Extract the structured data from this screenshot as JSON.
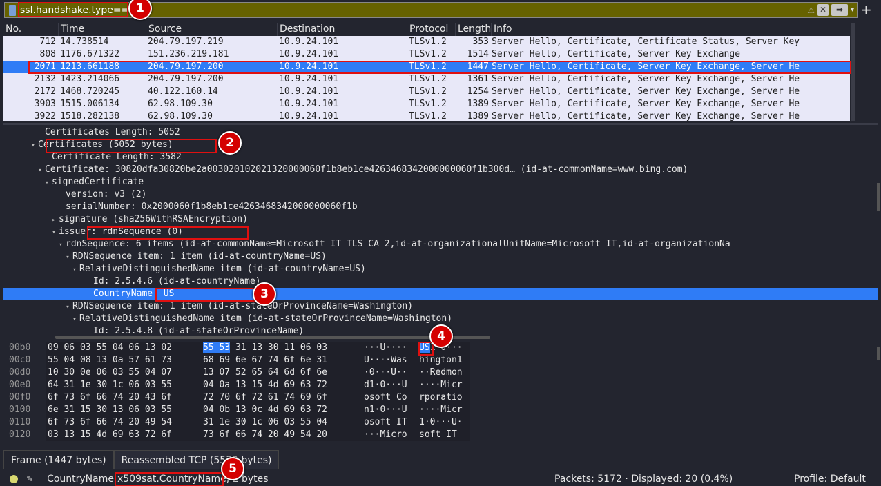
{
  "filter": {
    "value": "ssl.handshake.type==11",
    "clear_icon": "clear-icon",
    "apply_icon": "arrow-right-icon",
    "dropdown_icon": "chevron-down-icon",
    "add_label": "+"
  },
  "packet_list": {
    "columns": [
      "No.",
      "Time",
      "Source",
      "Destination",
      "Protocol",
      "Length",
      "Info"
    ],
    "rows": [
      [
        "712",
        "14.738514",
        "204.79.197.219",
        "10.9.24.101",
        "TLSv1.2",
        "353",
        "Server Hello, Certificate, Certificate Status, Server Key"
      ],
      [
        "808",
        "1176.671322",
        "151.236.219.181",
        "10.9.24.101",
        "TLSv1.2",
        "1514",
        "Server Hello, Certificate, Server Key Exchange"
      ],
      [
        "2071",
        "1213.661188",
        "204.79.197.200",
        "10.9.24.101",
        "TLSv1.2",
        "1447",
        "Server Hello, Certificate, Server Key Exchange, Server He"
      ],
      [
        "2132",
        "1423.214066",
        "204.79.197.200",
        "10.9.24.101",
        "TLSv1.2",
        "1361",
        "Server Hello, Certificate, Server Key Exchange, Server He"
      ],
      [
        "2172",
        "1468.720245",
        "40.122.160.14",
        "10.9.24.101",
        "TLSv1.2",
        "1254",
        "Server Hello, Certificate, Server Key Exchange, Server He"
      ],
      [
        "3903",
        "1515.006134",
        "62.98.109.30",
        "10.9.24.101",
        "TLSv1.2",
        "1389",
        "Server Hello, Certificate, Server Key Exchange, Server He"
      ],
      [
        "3922",
        "1518.282138",
        "62.98.109.30",
        "10.9.24.101",
        "TLSv1.2",
        "1389",
        "Server Hello, Certificate, Server Key Exchange, Server He"
      ]
    ],
    "selected_index": 2
  },
  "details": [
    {
      "text": "Certificates Length: 5052",
      "indent": 4,
      "tw": ""
    },
    {
      "text": "Certificates (5052 bytes)",
      "indent": 3,
      "tw": "▾"
    },
    {
      "text": "Certificate Length: 3582",
      "indent": 5,
      "tw": ""
    },
    {
      "text": "Certificate: 30820dfa30820be2a003020102021320000060f1b8eb1ce4263468342000000060f1b300d… (id-at-commonName=www.bing.com)",
      "indent": 4,
      "tw": "▾"
    },
    {
      "text": "signedCertificate",
      "indent": 5,
      "tw": "▾"
    },
    {
      "text": "version: v3 (2)",
      "indent": 7,
      "tw": ""
    },
    {
      "text": "serialNumber: 0x2000060f1b8eb1ce4263468342000000060f1b",
      "indent": 7,
      "tw": ""
    },
    {
      "text": "signature (sha256WithRSAEncryption)",
      "indent": 6,
      "tw": "▸"
    },
    {
      "text": "issuer: rdnSequence (0)",
      "indent": 6,
      "tw": "▾"
    },
    {
      "text": "rdnSequence: 6 items (id-at-commonName=Microsoft IT TLS CA 2,id-at-organizationalUnitName=Microsoft IT,id-at-organizationNa",
      "indent": 7,
      "tw": "▾"
    },
    {
      "text": "RDNSequence item: 1 item (id-at-countryName=US)",
      "indent": 8,
      "tw": "▾"
    },
    {
      "text": "RelativeDistinguishedName item (id-at-countryName=US)",
      "indent": 9,
      "tw": "▾"
    },
    {
      "text": "Id: 2.5.4.6 (id-at-countryName)",
      "indent": 11,
      "tw": ""
    },
    {
      "text": "CountryName: US",
      "indent": 11,
      "tw": ""
    },
    {
      "text": "RDNSequence item: 1 item (id-at-stateOrProvinceName=Washington)",
      "indent": 8,
      "tw": "▾"
    },
    {
      "text": "RelativeDistinguishedName item (id-at-stateOrProvinceName=Washington)",
      "indent": 9,
      "tw": "▾"
    },
    {
      "text": "Id: 2.5.4.8 (id-at-stateOrProvinceName)",
      "indent": 11,
      "tw": ""
    }
  ],
  "details_selected_index": 13,
  "hex": [
    {
      "off": "00b0",
      "b1": "09 06 03 55 04 06 13 02",
      "b2a": "55 53",
      "b2b": " 31 13 30 11 06 03",
      "a1": "···U····",
      "a2a": "US",
      "a2b": "1·0···"
    },
    {
      "off": "00c0",
      "b1": "55 04 08 13 0a 57 61 73",
      "b2b": "68 69 6e 67 74 6f 6e 31",
      "a1": "U····Was",
      "a2b": "hington1"
    },
    {
      "off": "00d0",
      "b1": "10 30 0e 06 03 55 04 07",
      "b2b": "13 07 52 65 64 6d 6f 6e",
      "a1": "·0···U··",
      "a2b": "··Redmon"
    },
    {
      "off": "00e0",
      "b1": "64 31 1e 30 1c 06 03 55",
      "b2b": "04 0a 13 15 4d 69 63 72",
      "a1": "d1·0···U",
      "a2b": "····Micr"
    },
    {
      "off": "00f0",
      "b1": "6f 73 6f 66 74 20 43 6f",
      "b2b": "72 70 6f 72 61 74 69 6f",
      "a1": "osoft Co",
      "a2b": "rporatio"
    },
    {
      "off": "0100",
      "b1": "6e 31 15 30 13 06 03 55",
      "b2b": "04 0b 13 0c 4d 69 63 72",
      "a1": "n1·0···U",
      "a2b": "····Micr"
    },
    {
      "off": "0110",
      "b1": "6f 73 6f 66 74 20 49 54",
      "b2b": "31 1e 30 1c 06 03 55 04",
      "a1": "osoft IT",
      "a2b": "1·0···U·"
    },
    {
      "off": "0120",
      "b1": "03 13 15 4d 69 63 72 6f",
      "b2b": "73 6f 66 74 20 49 54 20",
      "a1": "···Micro",
      "a2b": "soft IT "
    }
  ],
  "tabs": [
    "Frame (1447 bytes)",
    "Reassembled TCP (5539 bytes)"
  ],
  "status": {
    "field": "CountryName",
    "abbrev": "x509sat.CountryName",
    "size": ", 2 bytes",
    "packets": "Packets: 5172 · Displayed: 20 (0.4%)",
    "profile": "Profile: Default"
  },
  "annotations": [
    "1",
    "2",
    "3",
    "4",
    "5"
  ],
  "colors": {
    "selection": "#2f7cf6",
    "filter_bg": "#666200",
    "highlight_box": "#e01010"
  }
}
